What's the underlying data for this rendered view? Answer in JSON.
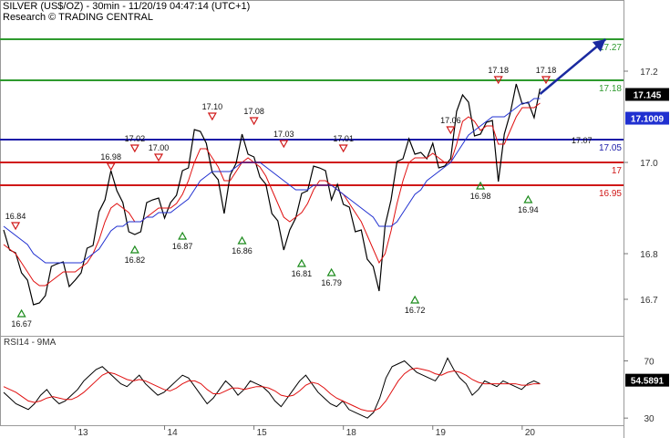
{
  "header": {
    "title": "SILVER (US$/OZ) - 30min - 11/20/19 04:47:14 (UTC+1)",
    "source": "Research © TRADING CENTRAL"
  },
  "chart_data": [
    {
      "type": "line",
      "ylim": [
        16.62,
        17.3
      ],
      "yticks": [
        16.7,
        16.8,
        17.0,
        17.2
      ],
      "ytick_labels": [
        "16.7",
        "16.8",
        "17.0",
        "17.2"
      ],
      "x_day_labels": [
        "13",
        "14",
        "15",
        "18",
        "19",
        "20"
      ],
      "x_day_index": [
        12,
        27,
        42,
        57,
        72,
        87
      ],
      "x_count": 91,
      "series": [
        {
          "color": "#000000",
          "values": [
            16.84,
            16.82,
            16.79,
            16.77,
            16.73,
            16.7,
            16.68,
            16.72,
            16.76,
            16.79,
            16.77,
            16.74,
            16.73,
            16.77,
            16.8,
            16.83,
            16.88,
            16.93,
            16.97,
            16.95,
            16.9,
            16.86,
            16.83,
            16.86,
            16.9,
            16.93,
            16.91,
            16.89,
            16.9,
            16.94,
            16.97,
            17.0,
            17.06,
            17.08,
            17.03,
            16.99,
            16.95,
            16.9,
            16.96,
            17.01,
            17.05,
            17.03,
            17.0,
            16.98,
            16.94,
            16.9,
            16.86,
            16.82,
            16.84,
            16.89,
            16.92,
            16.95,
            16.98,
            17.0,
            16.97,
            16.93,
            16.94,
            16.92,
            16.89,
            16.86,
            16.84,
            16.8,
            16.76,
            16.73,
            16.85,
            16.93,
            16.99,
            17.02,
            17.04,
            17.03,
            17.01,
            17.02,
            17.03,
            17.0,
            16.98,
            17.02,
            17.1,
            17.16,
            17.12,
            17.07,
            17.05,
            17.1,
            17.08,
            16.97,
            17.05,
            17.12,
            17.16,
            17.14,
            17.12,
            17.11,
            17.15
          ]
        },
        {
          "color": "#e01010",
          "values": [
            16.82,
            16.81,
            16.8,
            16.78,
            16.76,
            16.74,
            16.73,
            16.73,
            16.74,
            16.75,
            16.76,
            16.76,
            16.76,
            16.77,
            16.78,
            16.8,
            16.83,
            16.87,
            16.9,
            16.91,
            16.9,
            16.89,
            16.87,
            16.87,
            16.88,
            16.89,
            16.9,
            16.9,
            16.9,
            16.91,
            16.93,
            16.96,
            17.0,
            17.03,
            17.03,
            17.01,
            16.99,
            16.96,
            16.96,
            16.98,
            17.0,
            17.01,
            17.0,
            16.99,
            16.97,
            16.94,
            16.91,
            16.88,
            16.87,
            16.88,
            16.89,
            16.91,
            16.94,
            16.96,
            16.96,
            16.95,
            16.94,
            16.93,
            16.91,
            16.89,
            16.87,
            16.84,
            16.81,
            16.78,
            16.8,
            16.85,
            16.91,
            16.96,
            17.0,
            17.01,
            17.01,
            17.01,
            17.02,
            17.01,
            17.0,
            17.0,
            17.04,
            17.09,
            17.1,
            17.09,
            17.07,
            17.08,
            17.08,
            17.04,
            17.04,
            17.07,
            17.1,
            17.12,
            17.12,
            17.12,
            17.13
          ]
        },
        {
          "color": "#2030d0",
          "values": [
            16.86,
            16.85,
            16.84,
            16.83,
            16.82,
            16.8,
            16.79,
            16.78,
            16.78,
            16.78,
            16.78,
            16.78,
            16.78,
            16.78,
            16.79,
            16.8,
            16.81,
            16.83,
            16.85,
            16.86,
            16.86,
            16.87,
            16.87,
            16.87,
            16.88,
            16.88,
            16.89,
            16.89,
            16.89,
            16.9,
            16.91,
            16.92,
            16.94,
            16.96,
            16.97,
            16.98,
            16.98,
            16.98,
            16.98,
            16.99,
            17.0,
            17.0,
            17.0,
            17.0,
            16.99,
            16.98,
            16.97,
            16.96,
            16.95,
            16.94,
            16.94,
            16.94,
            16.95,
            16.95,
            16.95,
            16.95,
            16.94,
            16.93,
            16.92,
            16.91,
            16.9,
            16.89,
            16.88,
            16.86,
            16.86,
            16.86,
            16.87,
            16.89,
            16.91,
            16.93,
            16.94,
            16.96,
            16.97,
            16.98,
            16.99,
            17.0,
            17.02,
            17.04,
            17.06,
            17.07,
            17.08,
            17.09,
            17.1,
            17.1,
            17.1,
            17.11,
            17.12,
            17.13,
            17.13,
            17.14,
            17.14
          ]
        }
      ],
      "levels": [
        {
          "value": 17.27,
          "label": "17.27",
          "color": "#2e9a2e"
        },
        {
          "value": 17.18,
          "label": "17.18",
          "color": "#2e9a2e"
        },
        {
          "value": 17.05,
          "label": "17.05",
          "color": "#1c1ca8"
        },
        {
          "value": 17.0,
          "label": "17",
          "color": "#d01818"
        },
        {
          "value": 16.95,
          "label": "16.95",
          "color": "#d01818"
        }
      ],
      "current_price": {
        "label": "17.145",
        "value": 17.145
      },
      "value_badges": [
        {
          "label": "17.1009",
          "value": 17.1009,
          "color": "#2030d0"
        }
      ],
      "target_arrow": {
        "from": [
          90,
          17.15
        ],
        "to": [
          101,
          17.27
        ],
        "color": "#1a2aa0"
      },
      "annotations": [
        {
          "label": "16.84",
          "index": 2,
          "value": 16.84,
          "kind": "high"
        },
        {
          "label": "16.67",
          "index": 3,
          "value": 16.69,
          "kind": "low"
        },
        {
          "label": "16.98",
          "index": 18,
          "value": 16.97,
          "kind": "high"
        },
        {
          "label": "17.02",
          "index": 22,
          "value": 17.01,
          "kind": "high"
        },
        {
          "label": "17.00",
          "index": 26,
          "value": 16.99,
          "kind": "high"
        },
        {
          "label": "16.82",
          "index": 22,
          "value": 16.83,
          "kind": "low"
        },
        {
          "label": "16.87",
          "index": 30,
          "value": 16.86,
          "kind": "low"
        },
        {
          "label": "17.10",
          "index": 35,
          "value": 17.08,
          "kind": "high"
        },
        {
          "label": "17.08",
          "index": 42,
          "value": 17.07,
          "kind": "high"
        },
        {
          "label": "16.86",
          "index": 40,
          "value": 16.85,
          "kind": "low"
        },
        {
          "label": "17.03",
          "index": 47,
          "value": 17.02,
          "kind": "high"
        },
        {
          "label": "16.81",
          "index": 50,
          "value": 16.8,
          "kind": "low"
        },
        {
          "label": "16.79",
          "index": 55,
          "value": 16.78,
          "kind": "low"
        },
        {
          "label": "17.01",
          "index": 57,
          "value": 17.01,
          "kind": "high"
        },
        {
          "label": "16.72",
          "index": 69,
          "value": 16.72,
          "kind": "low"
        },
        {
          "label": "17.06",
          "index": 75,
          "value": 17.05,
          "kind": "high"
        },
        {
          "label": "16.98",
          "index": 80,
          "value": 16.97,
          "kind": "low"
        },
        {
          "label": "17.18",
          "index": 83,
          "value": 17.16,
          "kind": "high"
        },
        {
          "label": "16.94",
          "index": 88,
          "value": 16.94,
          "kind": "low"
        },
        {
          "label": "17.18",
          "index": 91,
          "value": 17.16,
          "kind": "high"
        },
        {
          "label": "17.07",
          "index": 97,
          "value": 17.07,
          "kind": "text"
        }
      ]
    },
    {
      "type": "line",
      "title": "RSI14 - 9MA",
      "ylim": [
        25,
        85
      ],
      "yticks": [
        30,
        70
      ],
      "ytick_labels": [
        "30",
        "70"
      ],
      "series": [
        {
          "color": "#000000",
          "values": [
            48,
            44,
            40,
            38,
            36,
            40,
            46,
            50,
            44,
            40,
            42,
            46,
            50,
            56,
            60,
            64,
            66,
            62,
            58,
            54,
            52,
            56,
            60,
            54,
            50,
            46,
            48,
            52,
            56,
            60,
            58,
            52,
            46,
            40,
            44,
            50,
            56,
            52,
            46,
            50,
            56,
            54,
            52,
            48,
            42,
            38,
            44,
            50,
            56,
            60,
            54,
            48,
            44,
            40,
            38,
            42,
            36,
            34,
            32,
            30,
            34,
            44,
            58,
            66,
            68,
            70,
            66,
            62,
            60,
            58,
            56,
            62,
            72,
            64,
            58,
            54,
            46,
            50,
            56,
            54,
            52,
            56,
            54,
            52,
            50,
            54,
            56,
            54
          ]
        },
        {
          "color": "#e01010",
          "values": [
            52,
            50,
            48,
            45,
            42,
            41,
            42,
            44,
            45,
            44,
            43,
            43,
            45,
            48,
            52,
            56,
            60,
            62,
            61,
            59,
            57,
            56,
            57,
            56,
            54,
            52,
            50,
            49,
            51,
            54,
            56,
            56,
            54,
            50,
            47,
            47,
            49,
            51,
            51,
            50,
            51,
            52,
            52,
            51,
            49,
            46,
            45,
            46,
            49,
            53,
            55,
            54,
            51,
            47,
            44,
            42,
            40,
            38,
            36,
            35,
            35,
            37,
            42,
            49,
            56,
            61,
            64,
            65,
            64,
            63,
            61,
            60,
            62,
            63,
            62,
            60,
            57,
            55,
            54,
            54,
            54,
            54,
            54,
            54,
            53,
            53,
            54,
            54
          ]
        }
      ],
      "value_badges": [
        {
          "label": "54.5891",
          "value": 54.5891,
          "color": "#000000"
        }
      ]
    }
  ]
}
